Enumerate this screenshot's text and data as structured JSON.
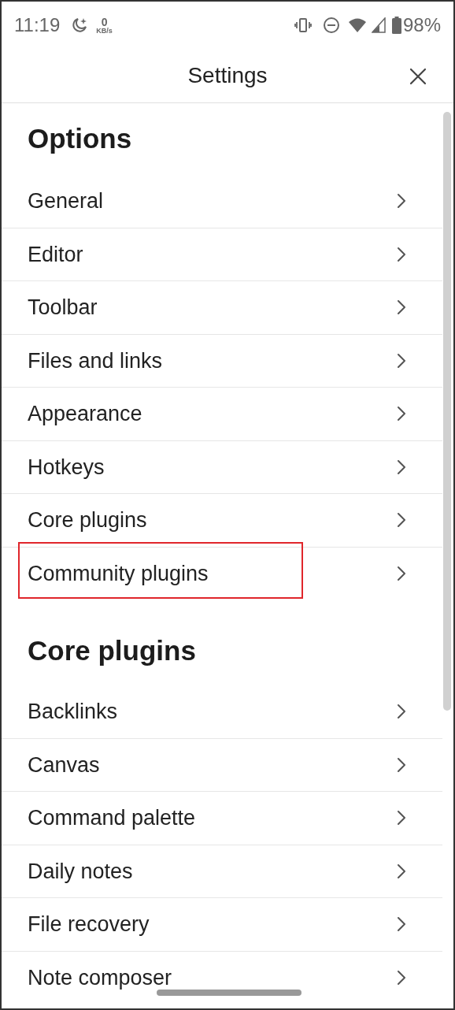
{
  "status_bar": {
    "time": "11:19",
    "net_speed_value": "0",
    "net_speed_unit": "KB/s",
    "battery": "98%"
  },
  "header": {
    "title": "Settings"
  },
  "sections": [
    {
      "heading": "Options",
      "items": [
        {
          "label": "General",
          "highlighted": false
        },
        {
          "label": "Editor",
          "highlighted": false
        },
        {
          "label": "Toolbar",
          "highlighted": false
        },
        {
          "label": "Files and links",
          "highlighted": false
        },
        {
          "label": "Appearance",
          "highlighted": false
        },
        {
          "label": "Hotkeys",
          "highlighted": false
        },
        {
          "label": "Core plugins",
          "highlighted": false
        },
        {
          "label": "Community plugins",
          "highlighted": true
        }
      ]
    },
    {
      "heading": "Core plugins",
      "items": [
        {
          "label": "Backlinks",
          "highlighted": false
        },
        {
          "label": "Canvas",
          "highlighted": false
        },
        {
          "label": "Command palette",
          "highlighted": false
        },
        {
          "label": "Daily notes",
          "highlighted": false
        },
        {
          "label": "File recovery",
          "highlighted": false
        },
        {
          "label": "Note composer",
          "highlighted": false
        }
      ]
    }
  ]
}
